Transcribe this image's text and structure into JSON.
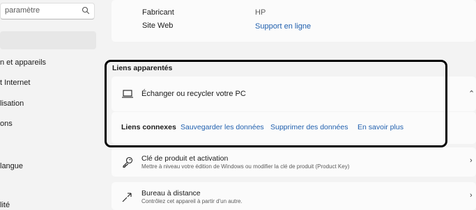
{
  "sidebar": {
    "search_placeholder": "paramètre",
    "items": [
      {
        "label": "n et appareils"
      },
      {
        "label": "t Internet"
      },
      {
        "label": "lisation"
      },
      {
        "label": "ons"
      },
      {
        "label": "langue"
      },
      {
        "label": "lité"
      }
    ]
  },
  "device": {
    "manufacturer_label": "Fabricant",
    "manufacturer_value": "HP",
    "website_label": "Site Web",
    "website_value": "Support en ligne"
  },
  "related": {
    "title": "Liens apparentés",
    "exchange_label": "Échanger ou recycler votre PC",
    "links_label": "Liens connexes",
    "links": [
      "Sauvegarder les données",
      "Supprimer des données",
      "En savoir plus"
    ]
  },
  "rows": [
    {
      "title": "Clé de produit et activation",
      "subtitle": "Mettre à niveau votre édition de Windows ou modifier la clé de produit (Product Key)"
    },
    {
      "title": "Bureau à distance",
      "subtitle": "Contrôlez cet appareil à partir d'un autre."
    }
  ],
  "icons": {
    "search": "search-icon",
    "laptop": "laptop-icon",
    "key": "key-icon",
    "remote": "remote-desktop-icon",
    "chevron_up": "chevron-up-icon",
    "chevron_right": "chevron-right-icon"
  },
  "colors": {
    "link": "#1f5fae",
    "highlight": "#000000"
  }
}
